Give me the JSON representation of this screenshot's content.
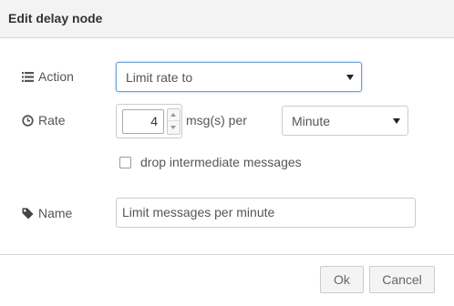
{
  "title": "Edit delay node",
  "action": {
    "label": "Action",
    "icon": "list-icon",
    "selected": "Limit rate to"
  },
  "rate": {
    "label": "Rate",
    "icon": "clock-icon",
    "value": "4",
    "unit_text": "msg(s) per",
    "period_selected": "Minute"
  },
  "drop": {
    "label": "drop intermediate messages",
    "checked": false
  },
  "name": {
    "label": "Name",
    "icon": "tag-icon",
    "value": "Limit messages per minute"
  },
  "buttons": {
    "ok": "Ok",
    "cancel": "Cancel"
  }
}
